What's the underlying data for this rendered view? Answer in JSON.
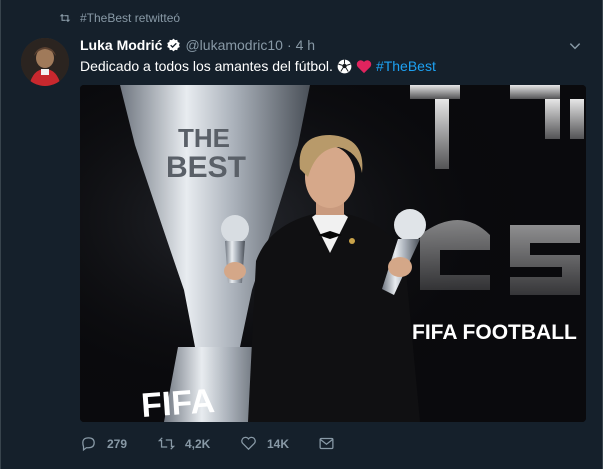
{
  "retweet_context": {
    "text": "#TheBest retwitteó",
    "icon": "retweet-icon"
  },
  "author": {
    "name": "Luka Modrić",
    "handle": "@lukamodric10",
    "separator": "·",
    "time": "4 h",
    "verified": true
  },
  "tweet": {
    "text": "Dedicado a todos los amantes del fútbol.",
    "emojis": [
      "soccer-ball-emoji",
      "red-heart-emoji"
    ],
    "hashtag": "#TheBest"
  },
  "media": {
    "type": "photo",
    "trophy_text_line1": "THE",
    "trophy_text_line2": "BEST",
    "trophy_base_text": "FIFA",
    "backdrop_text": "FIFA FOOTBALL"
  },
  "actions": {
    "replies": "279",
    "retweets": "4,2K",
    "likes": "14K"
  },
  "colors": {
    "background": "#15202b",
    "muted": "#8899a6",
    "accent": "#1da1f2",
    "heart": "#e0245e"
  }
}
